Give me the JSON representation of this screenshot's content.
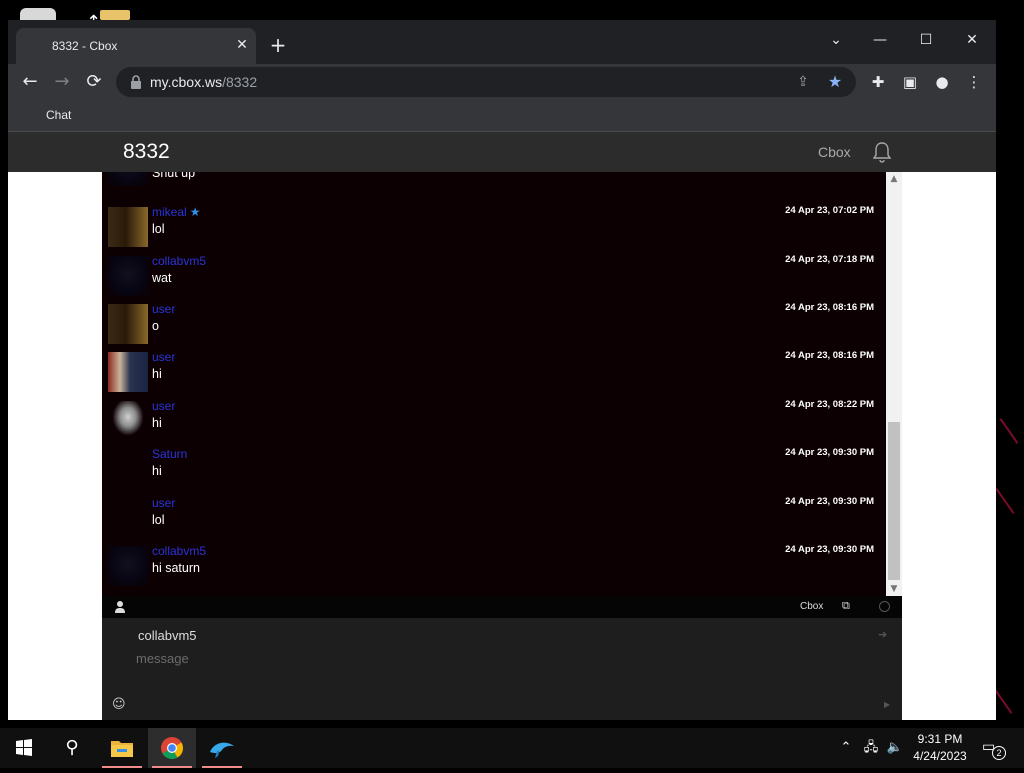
{
  "browser": {
    "tab_title": "8332 - Cbox",
    "url_domain": "my.cbox.ws",
    "url_path": "/8332",
    "bookmark": "Chat"
  },
  "site": {
    "title": "8332",
    "brand": "Cbox"
  },
  "messages": [
    {
      "user": "",
      "time": "",
      "text": "Shut up",
      "avatar": "dark"
    },
    {
      "user": "mikeal",
      "starred": true,
      "time": "24 Apr 23, 07:02 PM",
      "text": "lol",
      "avatar": "cat"
    },
    {
      "user": "collabvm5",
      "time": "24 Apr 23, 07:18 PM",
      "text": "wat",
      "avatar": "dark"
    },
    {
      "user": "user",
      "time": "24 Apr 23, 08:16 PM",
      "text": "o",
      "avatar": "cat"
    },
    {
      "user": "user",
      "time": "24 Apr 23, 08:16 PM",
      "text": "hi",
      "avatar": "suit"
    },
    {
      "user": "user",
      "time": "24 Apr 23, 08:22 PM",
      "text": "hi",
      "avatar": "ghost"
    },
    {
      "user": "Saturn",
      "time": "24 Apr 23, 09:30 PM",
      "text": "hi",
      "avatar": "none"
    },
    {
      "user": "user",
      "time": "24 Apr 23, 09:30 PM",
      "text": "lol",
      "avatar": "none"
    },
    {
      "user": "collabvm5",
      "time": "24 Apr 23, 09:30 PM",
      "text": "hi saturn",
      "avatar": "dark"
    }
  ],
  "cbox_bar": {
    "brand": "Cbox"
  },
  "compose": {
    "name": "collabvm5",
    "placeholder": "message"
  },
  "taskbar": {
    "time": "9:31 PM",
    "date": "4/24/2023",
    "notification_count": "2"
  },
  "colors": {
    "username": "#2b34d9",
    "chat_background": "#0c0003",
    "header_background": "#2c2c2c"
  }
}
